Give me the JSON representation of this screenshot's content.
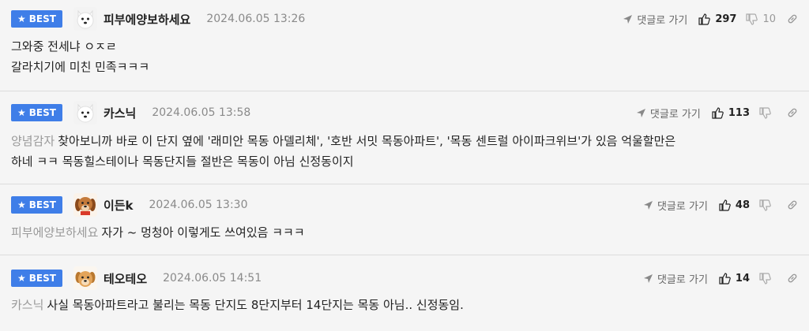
{
  "ui": {
    "badge_label": "BEST",
    "reply_label": "댓글로 가기",
    "badge_color": "#3f7ee8"
  },
  "comments": [
    {
      "nick": "피부에양보하세요",
      "date": "2024.06.05  13:26",
      "likes": "297",
      "dislikes": "10",
      "avatar": "white-dog-icon",
      "mention": "",
      "lines": [
        "그와중 전세냐 ㅇㅈㄹ",
        "갈라치기에 미친 민족ㅋㅋㅋ"
      ]
    },
    {
      "nick": "카스닉",
      "date": "2024.06.05  13:58",
      "likes": "113",
      "dislikes": "",
      "avatar": "white-dog-icon",
      "mention": "양념감자",
      "lines": [
        "찾아보니까 바로 이 단지 옆에 '래미안 목동 아델리체', '호반 서밋 목동아파트', '목동 센트럴 아이파크위브'가 있음 억울할만은",
        "하네 ㅋㅋ 목동힐스테이나 목동단지들 절반은 목동이 아님 신정동이지"
      ]
    },
    {
      "nick": "이든k",
      "date": "2024.06.05  13:30",
      "likes": "48",
      "dislikes": "",
      "avatar": "brown-dog-icon",
      "mention": "피부에양보하세요",
      "lines": [
        "자가 ~ 멍청아 이렇게도 쓰여있음 ㅋㅋㅋ"
      ]
    },
    {
      "nick": "테오테오",
      "date": "2024.06.05  14:51",
      "likes": "14",
      "dislikes": "",
      "avatar": "puppy-icon",
      "mention": "카스닉",
      "lines": [
        "사실 목동아파트라고 불리는 목동 단지도 8단지부터 14단지는 목동 아님.. 신정동임."
      ]
    }
  ]
}
